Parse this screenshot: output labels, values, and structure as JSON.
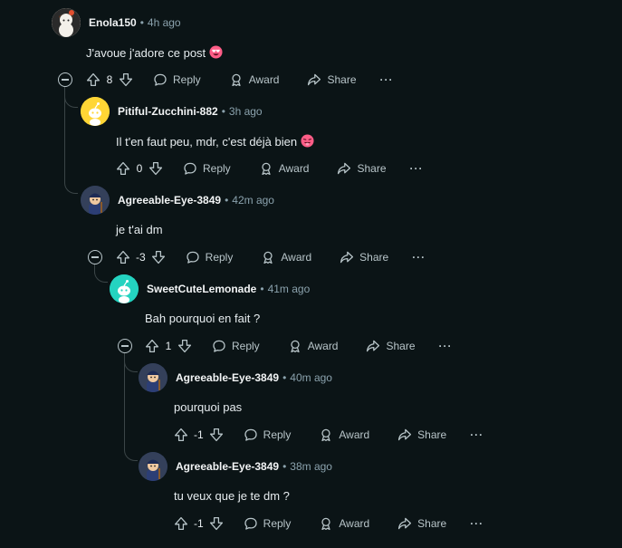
{
  "actions": {
    "reply": "Reply",
    "award": "Award",
    "share": "Share",
    "more": "···"
  },
  "comments": [
    {
      "author": "Enola150",
      "time": "4h ago",
      "text": "J'avoue j'adore ce post",
      "emoji": "heart-eyes",
      "votes": "8"
    },
    {
      "author": "Pitiful-Zucchini-882",
      "time": "3h ago",
      "text": "Il t'en faut peu, mdr, c'est déjà bien",
      "emoji": "tongue-wink",
      "votes": "0"
    },
    {
      "author": "Agreeable-Eye-3849",
      "time": "42m ago",
      "text": "je t'ai dm",
      "votes": "-3"
    },
    {
      "author": "SweetCuteLemonade",
      "time": "41m ago",
      "text": "Bah pourquoi en fait ?",
      "votes": "1"
    },
    {
      "author": "Agreeable-Eye-3849",
      "time": "40m ago",
      "text": "pourquoi pas",
      "votes": "-1"
    },
    {
      "author": "Agreeable-Eye-3849",
      "time": "38m ago",
      "text": "tu veux que je te dm ?",
      "votes": "-1"
    }
  ],
  "colors": {
    "background": "#0b1416",
    "muted": "#8ba2ad",
    "thread": "#3b4547",
    "pitiful_avatar": "#ffd635",
    "sweet_avatar": "#24d3c0"
  }
}
